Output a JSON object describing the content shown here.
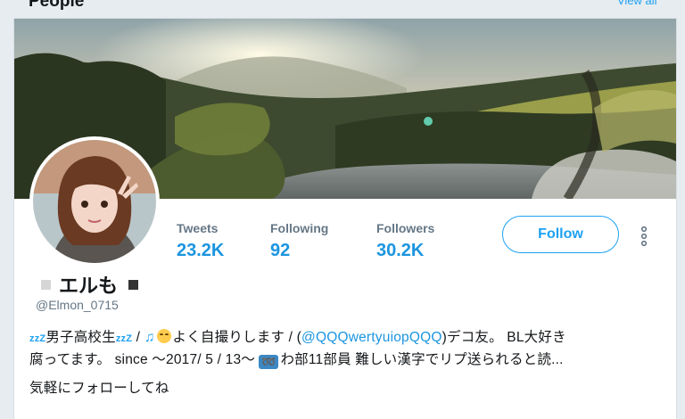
{
  "section": {
    "title": "People",
    "view_all": "View all"
  },
  "profile": {
    "display_name": "エルも",
    "handle": "@Elmon_0715",
    "stats": [
      {
        "label": "Tweets",
        "value": "23.2K"
      },
      {
        "label": "Following",
        "value": "92"
      },
      {
        "label": "Followers",
        "value": "30.2K"
      }
    ],
    "follow_label": "Follow",
    "bio": {
      "zz": "zzZ",
      "boys_school": "男子高校生",
      "slash": " / ",
      "notes": "♫",
      "selfie": "よく自撮りします / (",
      "mention": "@QQQwertyuiopQQQ",
      "deco": ")デコ友。 BL大好き",
      "line2_start": "腐ってます。 since ～2017/ 5 / 13～ ",
      "loop": "➿",
      "line2_end": "わ部11部員 難しい漢字でリプ送られると読...",
      "line3": "気軽にフォローしてね"
    },
    "colors": {
      "accent": "#1da1f2",
      "link": "#1b95e0",
      "text": "#14171a",
      "muted": "#657786"
    }
  }
}
